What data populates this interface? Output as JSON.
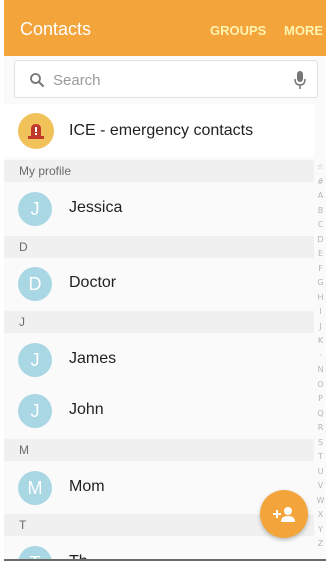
{
  "appbar": {
    "title": "Contacts",
    "groups_label": "GROUPS",
    "more_label": "MORE",
    "color": "#f3a43b"
  },
  "search": {
    "placeholder": "Search",
    "search_icon": "search-icon",
    "mic_icon": "microphone-icon"
  },
  "ice": {
    "label": "ICE - emergency contacts",
    "icon": "emergency-light-icon"
  },
  "sections": [
    {
      "header": "My profile",
      "contacts": [
        {
          "initial": "J",
          "name": "Jessica"
        }
      ]
    },
    {
      "header": "D",
      "contacts": [
        {
          "initial": "D",
          "name": "Doctor"
        }
      ]
    },
    {
      "header": "J",
      "contacts": [
        {
          "initial": "J",
          "name": "James"
        },
        {
          "initial": "J",
          "name": "John"
        }
      ]
    },
    {
      "header": "M",
      "contacts": [
        {
          "initial": "M",
          "name": "Mom"
        }
      ]
    },
    {
      "header": "T",
      "contacts": [
        {
          "initial": "T",
          "name": "Th"
        }
      ]
    }
  ],
  "index": [
    "☆",
    "#",
    "A",
    "B",
    "C",
    "D",
    "E",
    "F",
    "G",
    "H",
    "I",
    "J",
    "K",
    "·",
    "N",
    "O",
    "P",
    "Q",
    "R",
    "S",
    "T",
    "U",
    "V",
    "W",
    "X",
    "Y",
    "Z"
  ],
  "fab": {
    "icon": "add-contact-icon"
  }
}
